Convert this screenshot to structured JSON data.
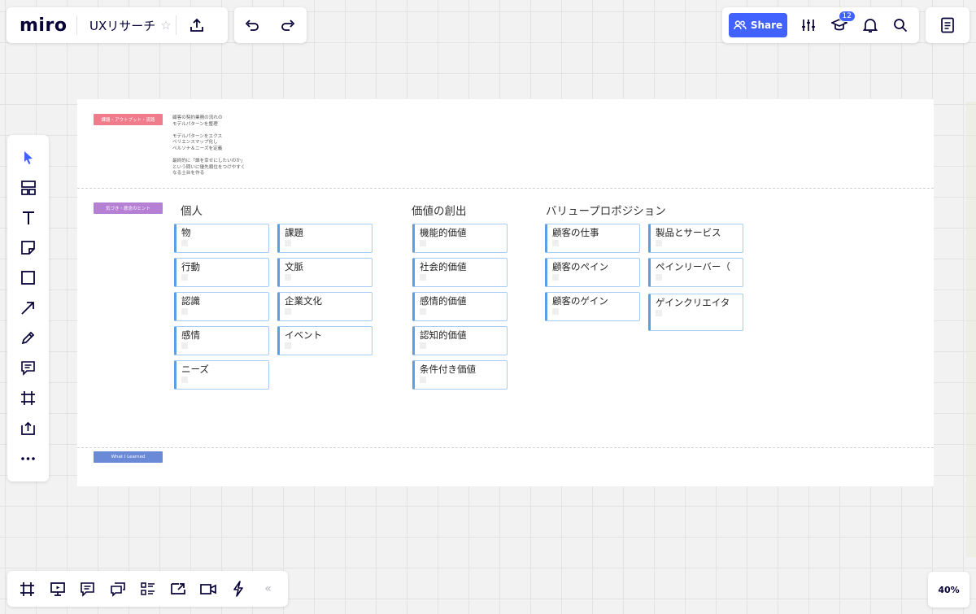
{
  "topbar": {
    "logo": "miro",
    "board_name": "UXリサーチ",
    "star_icon": "star-icon",
    "share_label": "Share",
    "notification_count": "12",
    "accent_color": "#4262ff"
  },
  "zoom": {
    "level": "40%"
  },
  "board": {
    "section_tags": [
      {
        "label": "課題・アウトプット・流路",
        "color": "#ef7b8b"
      },
      {
        "label": "気づき・懸念のヒント",
        "color": "#b57fd4"
      },
      {
        "label": "What I Learned",
        "color": "#6a89d6"
      }
    ],
    "memo": "顧客の契約業務の流れの\nモデルパターンを整理\n\nモデルパターンをエクス\nペリエンスマップ化し\nペルソナ＆ニーズを定義\n\n最終的に「誰を幸せにしたいのか」\nという問いに優先順位をつけやすく\nなる土台を作る",
    "groups": [
      {
        "heading": "個人",
        "col1": [
          "物",
          "行動",
          "認識",
          "感情",
          "ニーズ"
        ],
        "col2": [
          "課題",
          "文脈",
          "企業文化",
          "イベント"
        ]
      },
      {
        "heading": "価値の創出",
        "col1": [
          "機能的価値",
          "社会的価値",
          "感情的価値",
          "認知的価値",
          "条件付き価値"
        ]
      },
      {
        "heading": "バリュープロポジション",
        "col1": [
          "顧客の仕事",
          "顧客のペイン",
          "顧客のゲイン"
        ],
        "col2": [
          "製品とサービス",
          "ペインリーバー（",
          "ゲインクリエイタ"
        ]
      }
    ]
  }
}
